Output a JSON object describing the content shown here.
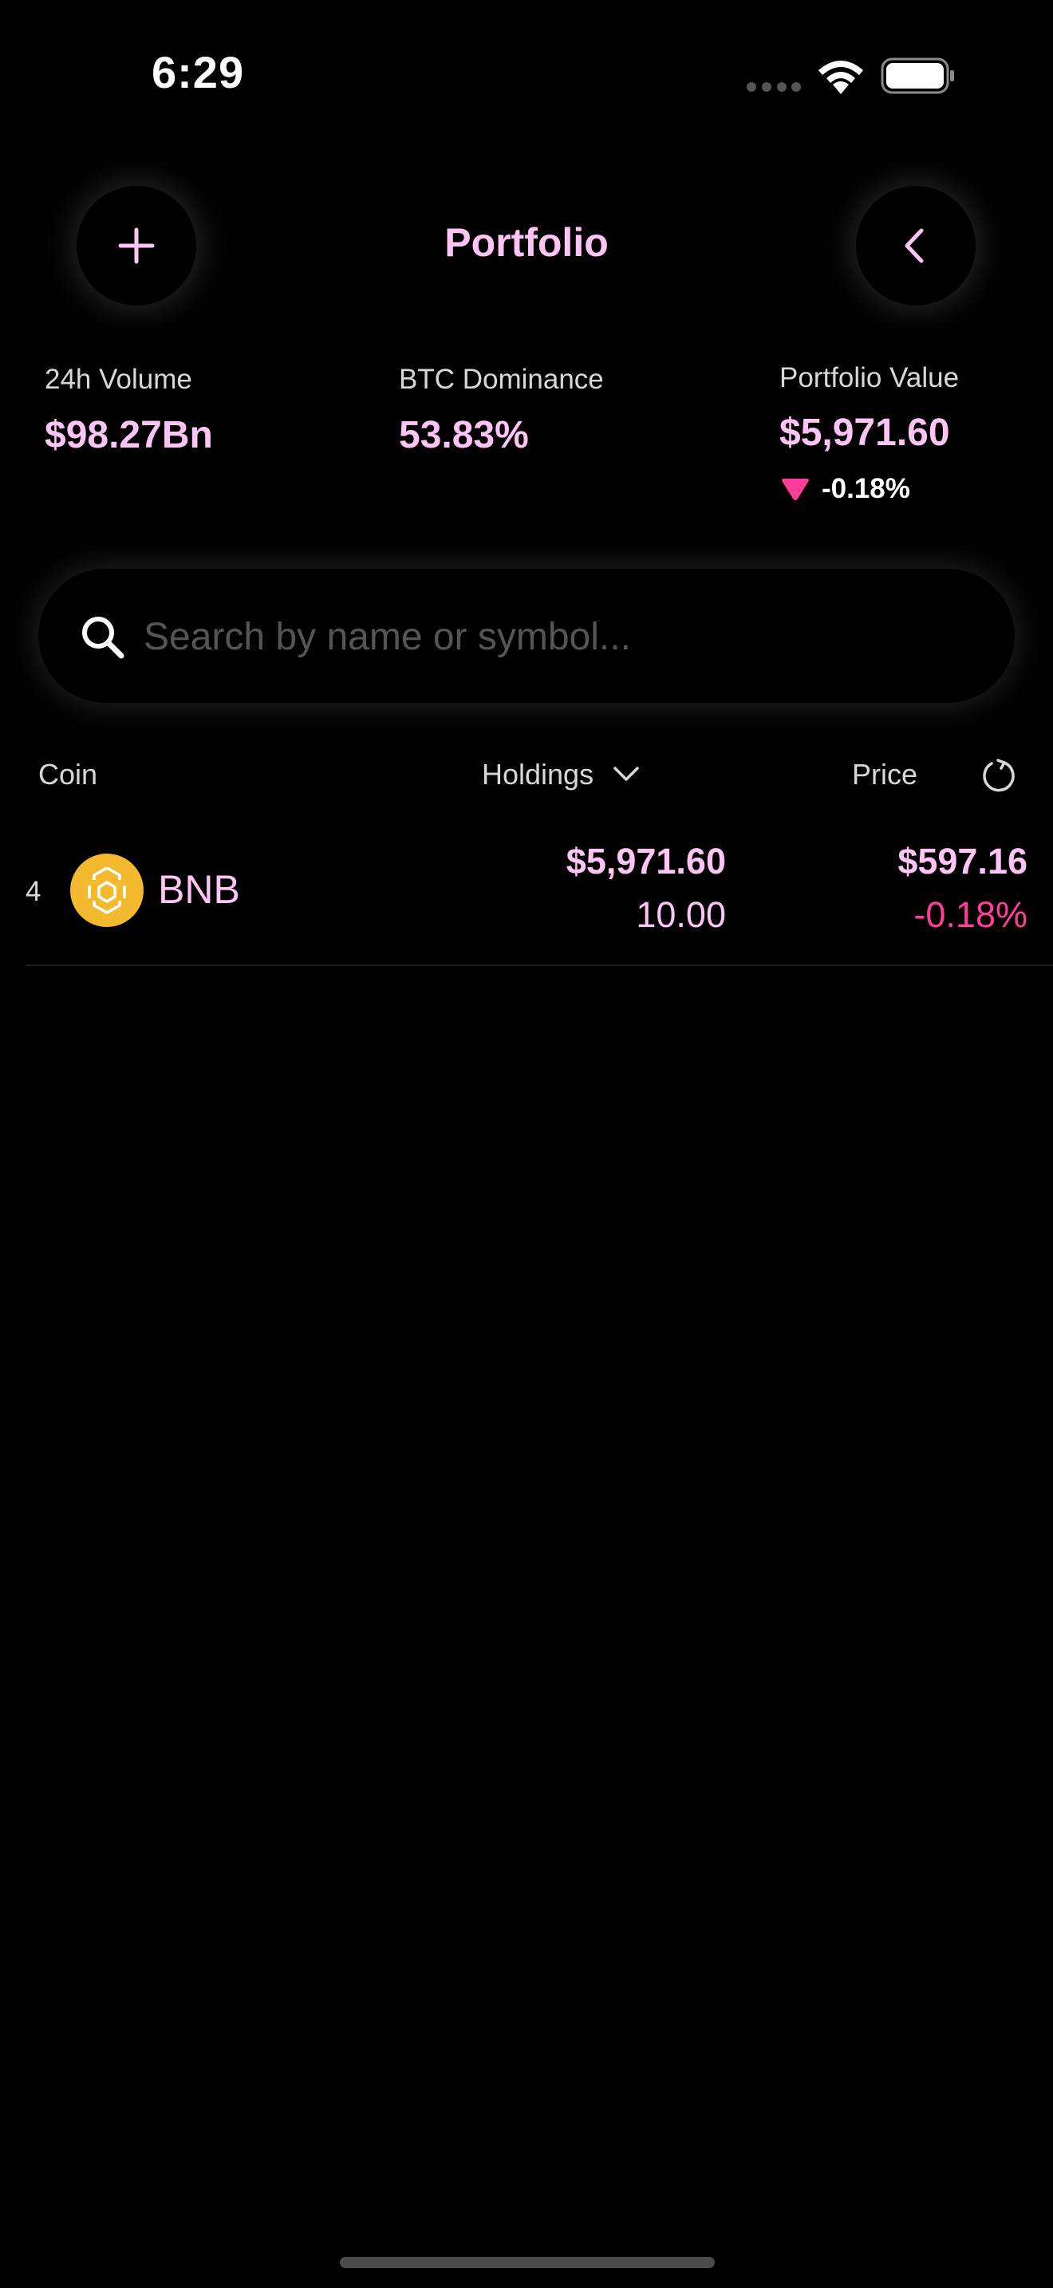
{
  "status_bar": {
    "time": "6:29"
  },
  "header": {
    "title": "Portfolio",
    "add_icon": "plus-icon",
    "back_icon": "chevron-left-icon"
  },
  "stats": {
    "volume": {
      "label": "24h Volume",
      "value": "$98.27Bn"
    },
    "dominance": {
      "label": "BTC Dominance",
      "value": "53.83%"
    },
    "portfolio": {
      "label": "Portfolio Value",
      "value": "$5,971.60",
      "change": "-0.18%",
      "change_icon": "triangle-down-icon"
    }
  },
  "search": {
    "placeholder": "Search by name or symbol...",
    "value": ""
  },
  "columns": {
    "coin": "Coin",
    "holdings": "Holdings",
    "price": "Price",
    "sort_icon": "chevron-down-icon",
    "reload_icon": "refresh-icon"
  },
  "rows": [
    {
      "rank": "4",
      "symbol": "BNB",
      "logo_icon": "bnb-logo-icon",
      "holdings_value": "$5,971.60",
      "holdings_amount": "10.00",
      "price": "$597.16",
      "change": "-0.18%"
    }
  ],
  "colors": {
    "background": "#000000",
    "accent": "#ffc4f6",
    "negative": "#ff3d9a",
    "coin_logo": "#f3ba2f",
    "label": "#d8d8d8"
  }
}
